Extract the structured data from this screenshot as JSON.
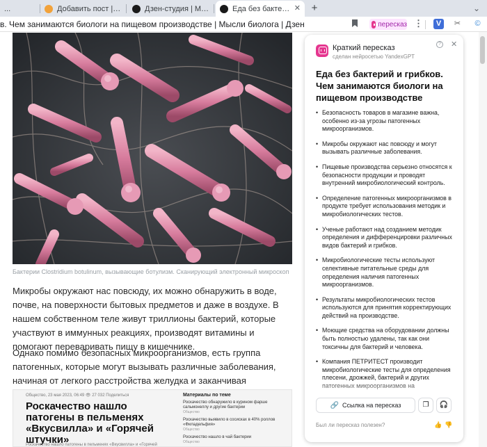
{
  "tabs": [
    {
      "title": "...",
      "active": false
    },
    {
      "title": "Добавить пост | Пикабу",
      "active": false
    },
    {
      "title": "Дзен-студия | Мысли биол",
      "active": false
    },
    {
      "title": "Еда без бактерий и гри",
      "active": true
    }
  ],
  "new_tab_label": "+",
  "address_bar": {
    "page_title": "в. Чем занимаются биологи на пищевом производстве | Мысли биолога | Дзен",
    "retell_label": "пересказ",
    "menu_label": "⋮"
  },
  "article": {
    "image_caption": "Бактерии Clostridium botulinum, вызывающие ботулизм. Сканирующий электронный микроскоп",
    "paragraphs": [
      "Микробы окружают нас повсюду, их можно обнаружить в воде, почве, на поверхности бытовых предметов и даже в воздухе. В нашем собственном теле живут триллионы бактерий, которые участвуют в иммунных реакциях, производят витамины и помогают переваривать пищу в кишечнике.",
      "Однако помимо безопасных микроорганизмов, есть группа патогенных, которые могут вызывать различные заболевания, начиная от легкого расстройства желудка и заканчивая тяжелыми инфекциями."
    ],
    "embed": {
      "meta": "Общество, 23 мая 2023, 06:49   👁 27 032   Поделиться",
      "title": "Роскачество нашло патогены в пельменях «Вкусвилла» и «Горячей штучки»",
      "lead": "Роскачество нашло патогены в пельменях «Вкусвилла» и «Горячей",
      "side_heading": "Материалы по теме",
      "side_items": [
        {
          "text": "Роскачество обнаружило в курином фарше сальмонеллу и другие бактерии",
          "source": "Общество"
        },
        {
          "text": "Роскачество выявило в сосисках в 40% роллов «Филадельфия»",
          "source": "Общество"
        },
        {
          "text": "Роскачество нашло в чай бактерии",
          "source": "Общество"
        }
      ]
    }
  },
  "summary_panel": {
    "header": "Краткий пересказ",
    "subheader": "сделан нейросетью YandexGPT",
    "info_label": "?",
    "close_label": "✕",
    "title": "Еда без бактерий и грибков. Чем занимаются биологи на пищевом производстве",
    "bullets": [
      "Безопасность товаров в магазине важна, особенно из-за угрозы патогенных микроорганизмов.",
      "Микробы окружают нас повсюду и могут вызывать различные заболевания.",
      "Пищевые производства серьезно относятся к безопасности продукции и проводят внутренний микробиологический контроль.",
      "Определение патогенных микроорганизмов в продукте требует использования методик и микробиологических тестов.",
      "Ученые работают над созданием методик определения и дифференцировки различных видов бактерий и грибков.",
      "Микробиологические тесты используют селективные питательные среды для определения наличия патогенных микроорганизмов.",
      "Результаты микробиологических тестов используются для принятия корректирующих действий на производстве.",
      "Моющие средства на оборудовании должны быть полностью удалены, так как они токсичны для бактерий и человека.",
      "Компания ПЕТРИТЕСТ производит микробиологические тесты для определения плесени, дрожжей, бактерий и других патогенных микроорганизмов на"
    ],
    "link_button": "Ссылка на пересказ",
    "feedback_question": "Был ли пересказ полезен?"
  },
  "icons": {
    "bookmark": "bookmark-icon",
    "extension_v": "V",
    "extension_scissors": "scissors-icon",
    "extension_cc": "cc-icon",
    "copy": "copy-icon",
    "audio": "headphones-icon",
    "like": "thumbs-up-icon",
    "dislike": "thumbs-down-icon"
  },
  "colors": {
    "accent_pink": "#e5368f",
    "retell_bg": "#fde4ff",
    "tabstrip_bg": "#dfe3ea",
    "bacteria_pink": "#d77c9d",
    "micrograph_bg": "#2f3236"
  }
}
